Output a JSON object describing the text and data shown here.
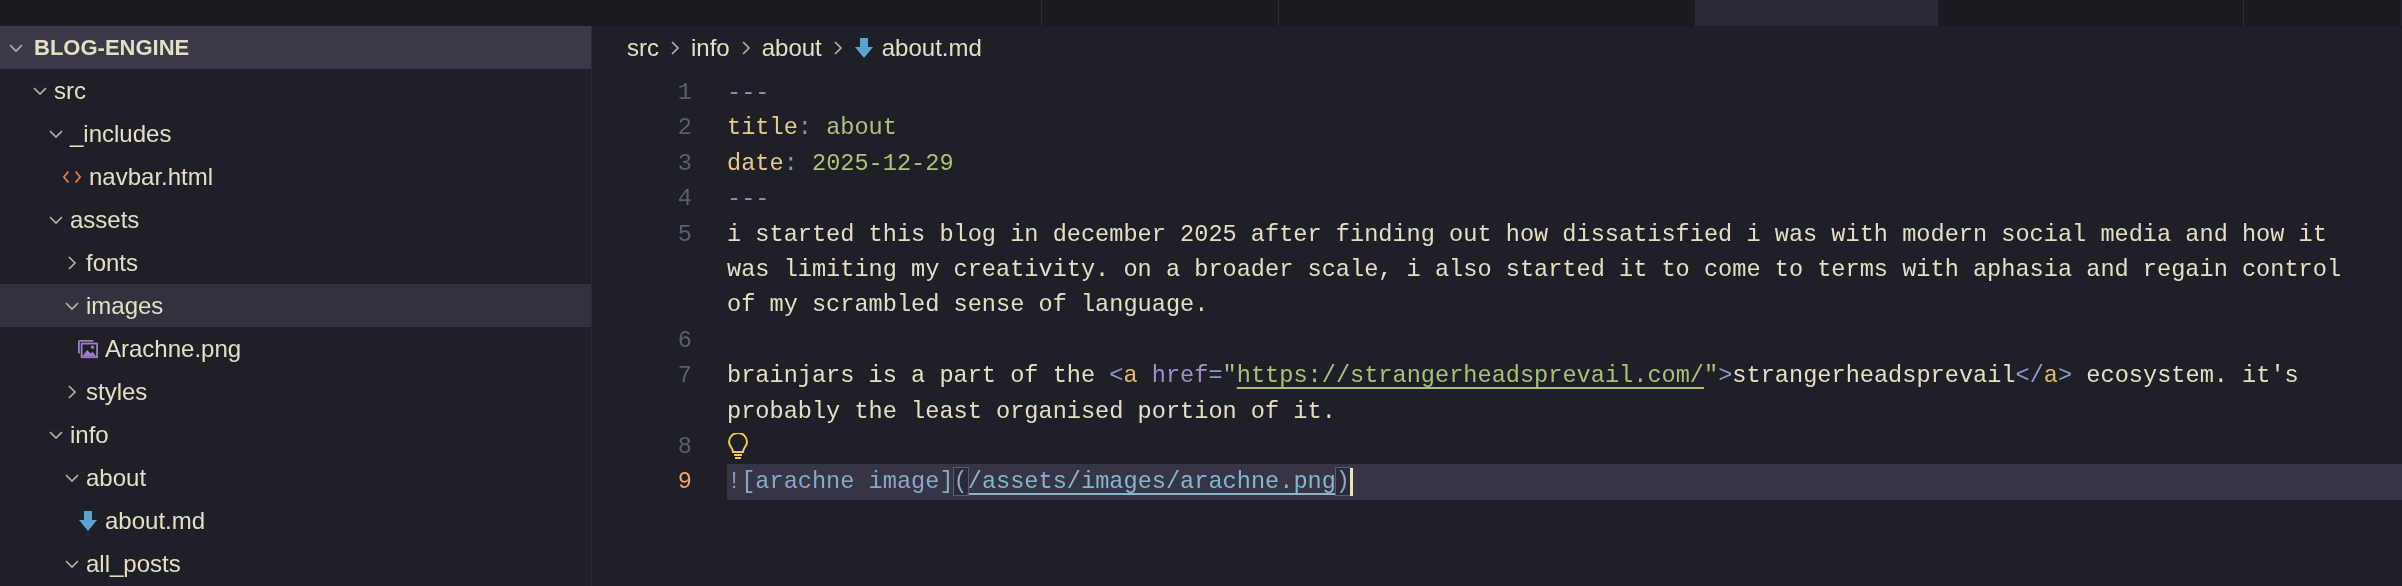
{
  "tabs": [
    {
      "selected": false
    },
    {
      "selected": false
    },
    {
      "selected": false
    },
    {
      "selected": true
    },
    {
      "selected": false
    },
    {
      "selected": false
    }
  ],
  "explorer": {
    "title": "BLOG-ENGINE",
    "expanded": true,
    "items": [
      {
        "label": "src",
        "kind": "folder",
        "expanded": true,
        "selected": false,
        "children": [
          {
            "label": "_includes",
            "kind": "folder",
            "expanded": true,
            "selected": false,
            "children": [
              {
                "label": "navbar.html",
                "kind": "html-file",
                "selected": false
              }
            ]
          },
          {
            "label": "assets",
            "kind": "folder",
            "expanded": true,
            "selected": false,
            "children": [
              {
                "label": "fonts",
                "kind": "folder",
                "expanded": false,
                "selected": false
              },
              {
                "label": "images",
                "kind": "folder",
                "expanded": true,
                "selected": true,
                "children": [
                  {
                    "label": "Arachne.png",
                    "kind": "image-file",
                    "selected": false
                  }
                ]
              },
              {
                "label": "styles",
                "kind": "folder",
                "expanded": false,
                "selected": false
              }
            ]
          },
          {
            "label": "info",
            "kind": "folder",
            "expanded": true,
            "selected": false,
            "children": [
              {
                "label": "about",
                "kind": "folder",
                "expanded": true,
                "selected": false,
                "children": [
                  {
                    "label": "about.md",
                    "kind": "markdown-file",
                    "selected": false
                  }
                ]
              },
              {
                "label": "all_posts",
                "kind": "folder",
                "expanded": true,
                "selected": false
              }
            ]
          }
        ]
      }
    ]
  },
  "breadcrumb": [
    {
      "label": "src",
      "kind": "folder"
    },
    {
      "label": "info",
      "kind": "folder"
    },
    {
      "label": "about",
      "kind": "folder"
    },
    {
      "label": "about.md",
      "kind": "markdown-file"
    }
  ],
  "editor": {
    "lines": [
      {
        "number": "1",
        "kind": "text",
        "current": false,
        "rows": [
          [
            {
              "text": "---",
              "kind": "punct"
            }
          ]
        ]
      },
      {
        "number": "2",
        "kind": "text",
        "current": false,
        "rows": [
          [
            {
              "text": "title",
              "kind": "key"
            },
            {
              "text": ": ",
              "kind": "punct"
            },
            {
              "text": "about",
              "kind": "value"
            }
          ]
        ]
      },
      {
        "number": "3",
        "kind": "text",
        "current": false,
        "rows": [
          [
            {
              "text": "date",
              "kind": "key"
            },
            {
              "text": ": ",
              "kind": "punct"
            },
            {
              "text": "2025-12-29",
              "kind": "value"
            }
          ]
        ]
      },
      {
        "number": "4",
        "kind": "text",
        "current": false,
        "rows": [
          [
            {
              "text": "---",
              "kind": "punct"
            }
          ]
        ]
      },
      {
        "number": "5",
        "kind": "text",
        "current": false,
        "rows": [
          [
            {
              "text": "i started this blog in december 2025 after finding out how dissatisfied i was with modern social media and how it",
              "kind": "plain"
            }
          ],
          [
            {
              "text": "was limiting my creativity. on a broader scale, i also started it to come to terms with aphasia and regain control",
              "kind": "plain"
            }
          ],
          [
            {
              "text": "of my scrambled sense of language.",
              "kind": "plain"
            }
          ]
        ]
      },
      {
        "number": "6",
        "kind": "blank",
        "current": false
      },
      {
        "number": "7",
        "kind": "text",
        "current": false,
        "rows": [
          [
            {
              "text": "brainjars is a part of the ",
              "kind": "plain"
            },
            {
              "text": "<",
              "kind": "tag-punct"
            },
            {
              "text": "a",
              "kind": "tag"
            },
            {
              "text": " ",
              "kind": "plain"
            },
            {
              "text": "href",
              "kind": "attr"
            },
            {
              "text": "=",
              "kind": "tag-punct"
            },
            {
              "text": "\"",
              "kind": "string"
            },
            {
              "text": "https://strangerheadsprevail.com/",
              "kind": "string-link"
            },
            {
              "text": "\"",
              "kind": "string"
            },
            {
              "text": ">",
              "kind": "tag-punct"
            },
            {
              "text": "strangerheadsprevail",
              "kind": "plain"
            },
            {
              "text": "</",
              "kind": "tag-punct"
            },
            {
              "text": "a",
              "kind": "tag"
            },
            {
              "text": ">",
              "kind": "tag-punct"
            },
            {
              "text": " ecosystem. it's",
              "kind": "plain"
            }
          ],
          [
            {
              "text": "probably the least organised portion of it.",
              "kind": "plain"
            }
          ]
        ]
      },
      {
        "number": "8",
        "kind": "hint",
        "current": false
      },
      {
        "number": "9",
        "kind": "text",
        "current": true,
        "cursor": true,
        "rows": [
          [
            {
              "text": "!",
              "kind": "punct"
            },
            {
              "text": "[arachne image]",
              "kind": "link-text"
            },
            {
              "text": "(",
              "kind": "bracket-match"
            },
            {
              "text": "/assets/images/arachne.png",
              "kind": "link-url"
            },
            {
              "text": ")",
              "kind": "bracket-match"
            }
          ]
        ]
      }
    ]
  }
}
